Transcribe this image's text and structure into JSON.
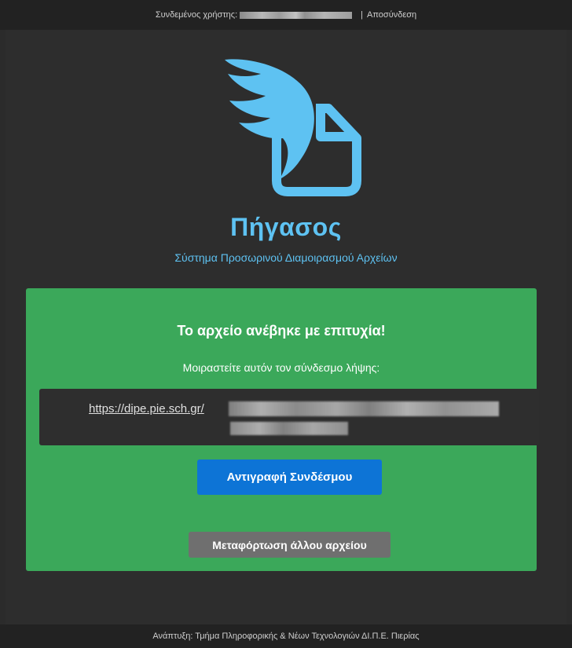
{
  "topbar": {
    "logged_in_label": "Συνδεμένος χρήστης:",
    "separator": "|",
    "logout_label": "Αποσύνδεση"
  },
  "header": {
    "logo_icon": "winged-document-icon",
    "title": "Πήγασος",
    "subtitle": "Σύστημα Προσωρινού Διαμοιρασμού Αρχείων"
  },
  "upload_result": {
    "heading": "Το αρχείο ανέβηκε με επιτυχία!",
    "share_text": "Μοιραστείτε αυτόν τον σύνδεσμο λήψης:",
    "link_visible": "https://dipe.pie.sch.gr/",
    "copy_button": "Αντιγραφή Συνδέσμου",
    "upload_another_button": "Μεταφόρτωση άλλου αρχείου"
  },
  "footer": {
    "text": "Ανάπτυξη: Τμήμα Πληροφορικής & Νέων Τεχνολογιών ΔΙ.Π.Ε. Πιερίας"
  },
  "colors": {
    "background": "#2d2d2d",
    "accent": "#5ec2f2",
    "success": "#3ba85a",
    "primary_button": "#0d74d6",
    "secondary_button": "#6f6f6f"
  }
}
